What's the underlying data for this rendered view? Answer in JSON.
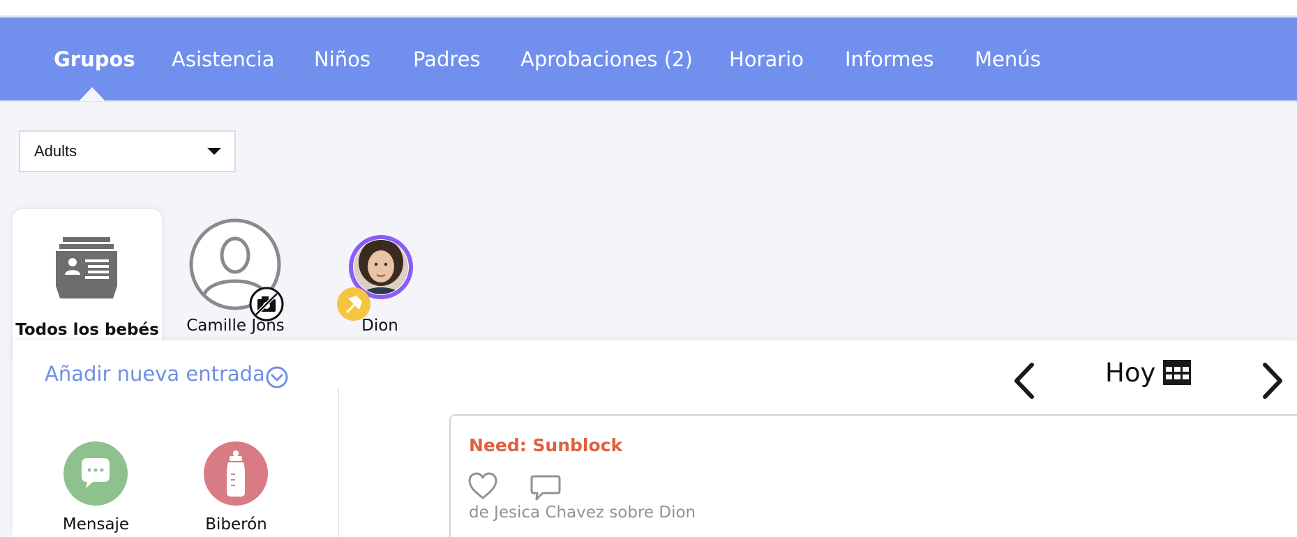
{
  "nav": {
    "items": [
      {
        "label": "Grupos",
        "active": true
      },
      {
        "label": "Asistencia"
      },
      {
        "label": "Niños"
      },
      {
        "label": "Padres"
      },
      {
        "label": "Aprobaciones (2)"
      },
      {
        "label": "Horario"
      },
      {
        "label": "Informes"
      },
      {
        "label": "Menús"
      }
    ]
  },
  "group_select": {
    "value": "Adults"
  },
  "children": {
    "all_label": "Todos los bebés",
    "list": [
      {
        "name": "Camille Jons",
        "avatar": "placeholder-person-icon",
        "badge": "no-photo-icon"
      },
      {
        "name": "Dion",
        "avatar": "photo",
        "badge": "pin-icon"
      }
    ]
  },
  "entries": {
    "add_label": "Añadir nueva entrada",
    "quick_actions": [
      {
        "label": "Mensaje",
        "icon": "chat-bubble-icon",
        "color": "#8fc18f"
      },
      {
        "label": "Biberón",
        "icon": "bottle-icon",
        "color": "#d97b84"
      }
    ]
  },
  "date_nav": {
    "label": "Hoy"
  },
  "feed": [
    {
      "title": "Need: Sunblock",
      "meta": "de Jesica Chavez sobre Dion"
    }
  ],
  "colors": {
    "nav_bg": "#7190ee",
    "accent": "#6f8fe6",
    "entry_title": "#e0613e",
    "pin_badge": "#f5c443",
    "avatar_ring": "#8b5cf6"
  }
}
